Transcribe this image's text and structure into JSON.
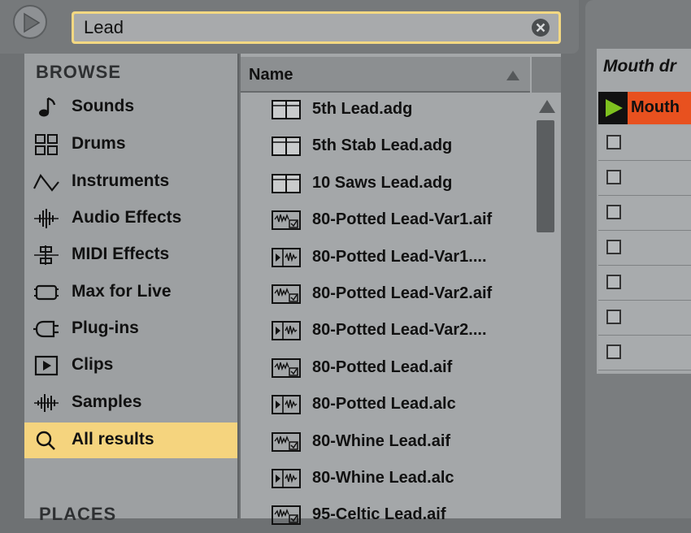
{
  "search": {
    "query": "Lead"
  },
  "browse": {
    "heading": "BROWSE",
    "categories": [
      {
        "label": "Sounds",
        "icon": "note-icon"
      },
      {
        "label": "Drums",
        "icon": "grid-icon"
      },
      {
        "label": "Instruments",
        "icon": "wave-icon"
      },
      {
        "label": "Audio Effects",
        "icon": "audio-effect-icon"
      },
      {
        "label": "MIDI Effects",
        "icon": "midi-effect-icon"
      },
      {
        "label": "Max for Live",
        "icon": "max-icon"
      },
      {
        "label": "Plug-ins",
        "icon": "plug-icon"
      },
      {
        "label": "Clips",
        "icon": "clip-icon"
      },
      {
        "label": "Samples",
        "icon": "sample-icon"
      },
      {
        "label": "All results",
        "icon": "search-icon",
        "selected": true
      }
    ],
    "places_heading": "PLACES"
  },
  "filelist": {
    "column_header": "Name",
    "files": [
      {
        "name": "5th Lead.adg",
        "type": "rack"
      },
      {
        "name": "5th Stab Lead.adg",
        "type": "rack"
      },
      {
        "name": "10 Saws Lead.adg",
        "type": "rack"
      },
      {
        "name": "80-Potted Lead-Var1.aif",
        "type": "sample"
      },
      {
        "name": "80-Potted Lead-Var1....",
        "type": "clip"
      },
      {
        "name": "80-Potted Lead-Var2.aif",
        "type": "sample"
      },
      {
        "name": "80-Potted Lead-Var2....",
        "type": "clip"
      },
      {
        "name": "80-Potted Lead.aif",
        "type": "sample"
      },
      {
        "name": "80-Potted Lead.alc",
        "type": "clip"
      },
      {
        "name": "80-Whine Lead.aif",
        "type": "sample"
      },
      {
        "name": "80-Whine Lead.alc",
        "type": "clip"
      },
      {
        "name": "95-Celtic Lead.aif",
        "type": "sample"
      }
    ]
  },
  "session": {
    "track_title": "Mouth dr",
    "clip_name": "Mouth",
    "colors": {
      "clip": "#e8511f",
      "play": "#7ec11f",
      "selection": "#f5d47e"
    }
  }
}
